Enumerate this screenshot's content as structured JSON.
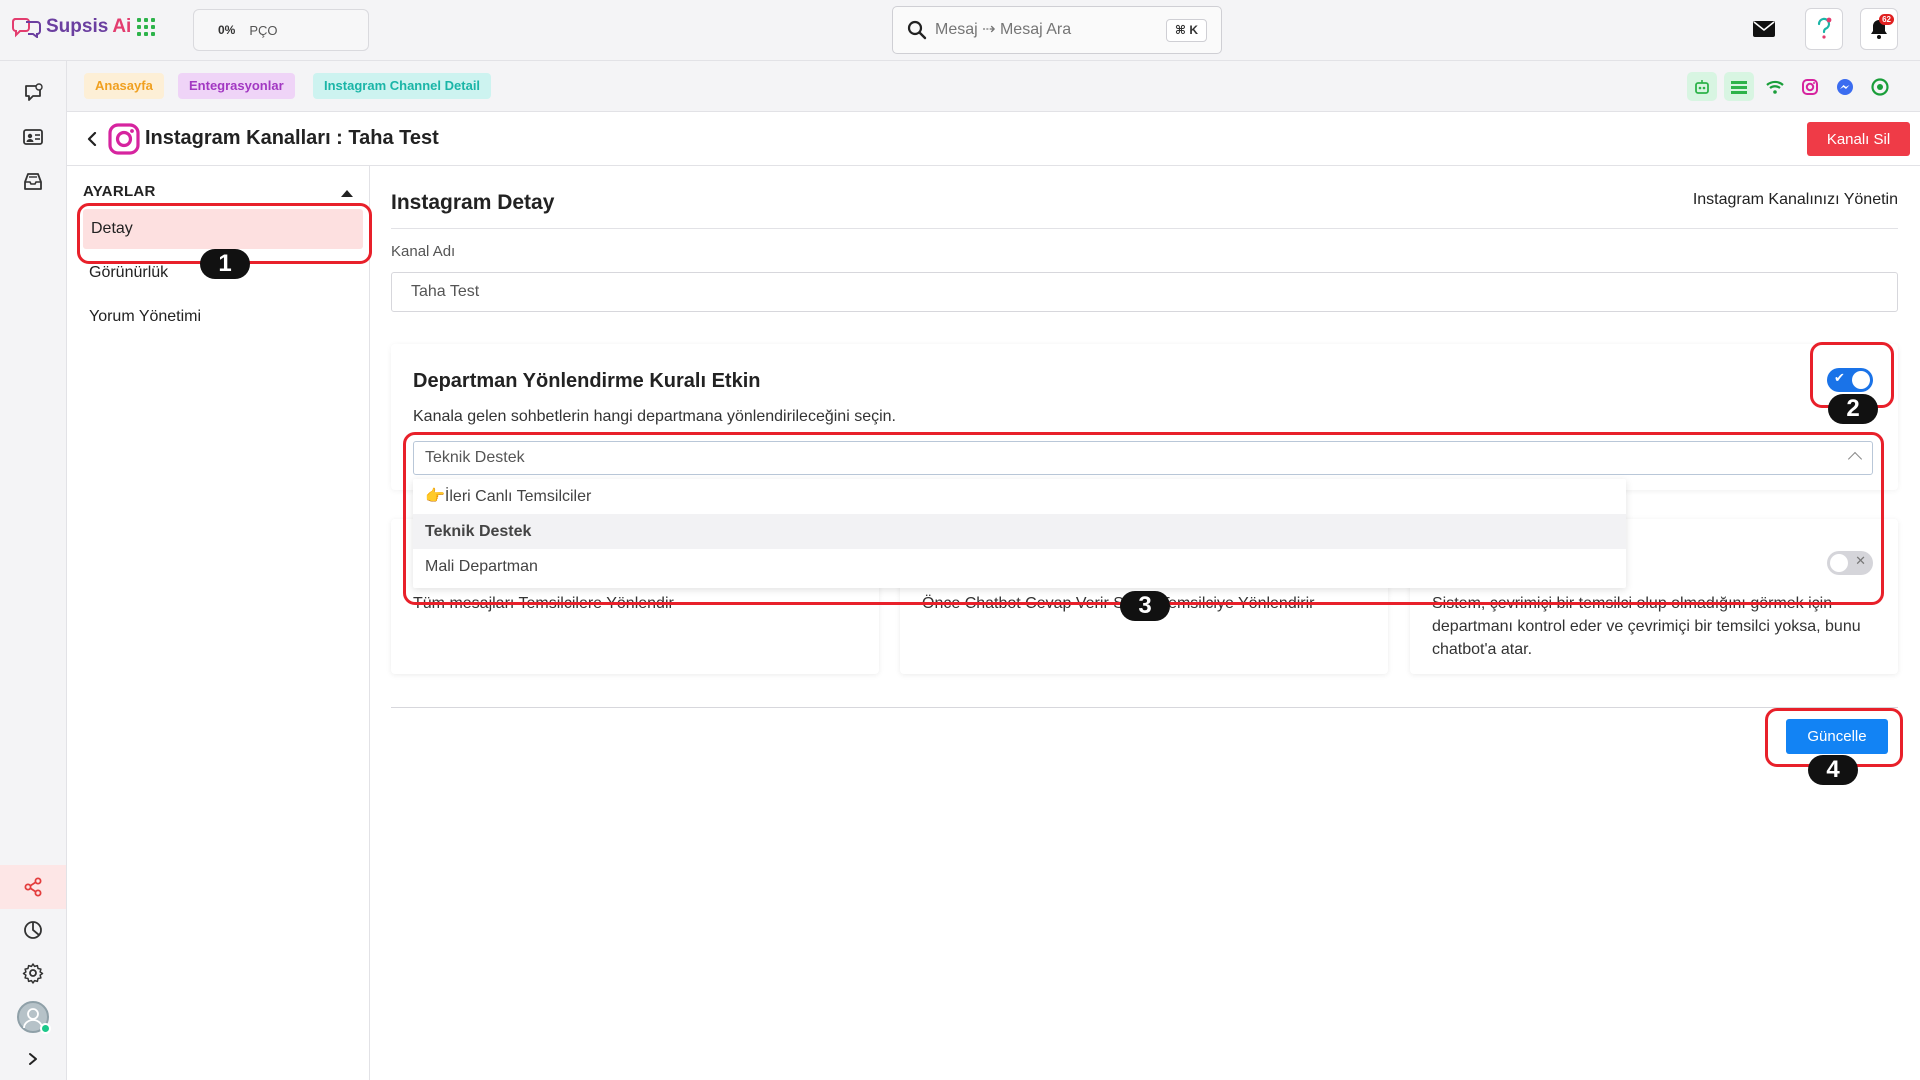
{
  "app": {
    "logo_name": "Supsis",
    "logo_suffix": "Ai"
  },
  "topbar": {
    "status_percent": "0%",
    "status_label": "PÇO",
    "search_placeholder": "Mesaj ⇢ Mesaj Ara",
    "search_shortcut": "⌘ K",
    "notification_count": "62",
    "icons": [
      "apps-grid-icon",
      "search-icon",
      "mail-icon",
      "help-icon",
      "bell-icon"
    ]
  },
  "rail": {
    "icons": [
      "chat-icon",
      "contacts-icon",
      "inbox-icon",
      "share-icon",
      "reports-icon",
      "settings-icon",
      "avatar",
      "expand-icon"
    ],
    "active_color": "#fde6e6"
  },
  "breadcrumbs": [
    "Anasayfa",
    "Entegrasyonlar",
    "Instagram Channel Detail"
  ],
  "channel_icons": [
    "bot-icon",
    "list-icon",
    "wifi-icon",
    "instagram-icon",
    "messenger-icon",
    "whatsapp-icon"
  ],
  "header": {
    "title": "Instagram Kanalları : Taha Test",
    "delete_label": "Kanalı Sil"
  },
  "settings": {
    "heading": "AYARLAR",
    "items": [
      {
        "label": "Detay",
        "active": true
      },
      {
        "label": "Görünürlük",
        "active": false
      },
      {
        "label": "Yorum Yönetimi",
        "active": false
      }
    ]
  },
  "main": {
    "title": "Instagram Detay",
    "subtitle": "Instagram Kanalınızı Yönetin",
    "channel_name_label": "Kanal Adı",
    "channel_name_value": "Taha Test",
    "rule": {
      "title": "Departman Yönlendirme Kuralı Etkin",
      "description": "Kanala gelen sohbetlerin hangi departmana yönlendirileceğini seçin.",
      "enabled": true,
      "selected_department": "Teknik Destek",
      "options": [
        "👉İleri Canlı Temsilciler",
        "Teknik Destek",
        "Mali Departman"
      ]
    },
    "cards": [
      {
        "text": "Tüm mesajları Temsilcilere Yönlendir"
      },
      {
        "text": "Önce Chatbot Cevap Verir Sonra Temsilciye Yönlendirir"
      },
      {
        "text": "Sistem, çevrimiçi bir temsilci olup olmadığını görmek için departmanı kontrol eder ve çevrimiçi bir temsilci yoksa, bunu chatbot'a atar.",
        "toggle_enabled": false
      }
    ],
    "update_label": "Güncelle"
  },
  "annotations": [
    "1",
    "2",
    "3",
    "4"
  ],
  "colors": {
    "accent": "#1283f4",
    "danger": "#ef3b47",
    "highlight": "#e8202a"
  }
}
